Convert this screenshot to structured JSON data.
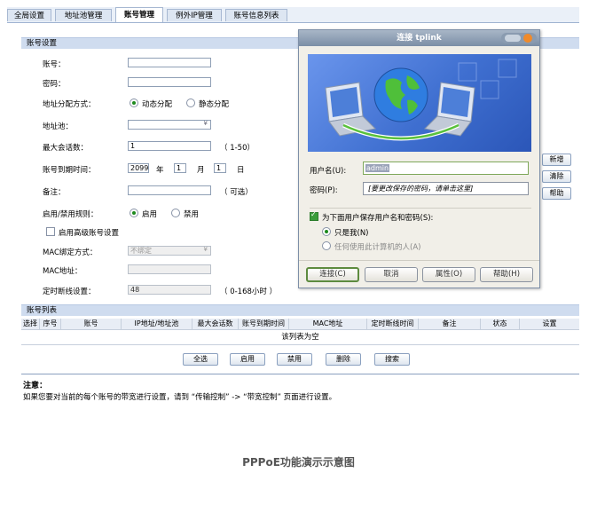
{
  "tabs": [
    "全局设置",
    "地址池管理",
    "账号管理",
    "例外IP管理",
    "账号信息列表"
  ],
  "active_tab": 2,
  "account_settings": {
    "section_title": "账号设置",
    "account_label": "账号：",
    "password_label": "密码：",
    "addr_mode_label": "地址分配方式：",
    "addr_mode_dynamic": "动态分配",
    "addr_mode_static": "静态分配",
    "pool_label": "地址池：",
    "max_session_label": "最大会话数：",
    "max_session_value": "1",
    "max_session_hint": "（ 1-50）",
    "expire_label": "账号到期时间：",
    "expire_year": "2099",
    "year_unit": "年",
    "expire_month": "1",
    "month_unit": "月",
    "expire_day": "1",
    "day_unit": "日",
    "note_label": "备注：",
    "note_hint": "（ 可选）",
    "rule_label": "启用/禁用规则：",
    "rule_enable": "启用",
    "rule_disable": "禁用",
    "advanced_label": "启用高级账号设置",
    "mac_bind_label": "MAC绑定方式：",
    "mac_bind_value": "不绑定",
    "mac_addr_label": "MAC地址：",
    "timeout_label": "定时断线设置：",
    "timeout_value": "48",
    "timeout_hint": "（ 0-168小时 ）"
  },
  "side_buttons": [
    "新增",
    "清除",
    "帮助"
  ],
  "account_list": {
    "section_title": "账号列表",
    "columns": [
      "选择",
      "序号",
      "账号",
      "IP地址/地址池",
      "最大会话数",
      "账号到期时间",
      "MAC地址",
      "定时断线时间",
      "备注",
      "状态",
      "设置"
    ],
    "empty_text": "该列表为空",
    "buttons": [
      "全选",
      "启用",
      "禁用",
      "删除",
      "搜索"
    ]
  },
  "notice": {
    "title": "注意：",
    "text": "如果您要对当前的每个账号的带宽进行设置，请到 “传输控制” -> “带宽控制” 页面进行设置。"
  },
  "dialog": {
    "title": "连接 tplink",
    "username_label": "用户名(U):",
    "username_value": "admin",
    "password_label": "密码(P):",
    "password_value": "[要更改保存的密码，请单击这里]",
    "save_label": "为下面用户保存用户名和密码(S):",
    "only_me": "只是我(N)",
    "anyone": "任何使用此计算机的人(A)",
    "buttons": [
      "连接(C)",
      "取消",
      "属性(O)",
      "帮助(H)"
    ]
  },
  "caption": "PPPoE功能演示示意图",
  "colors": {
    "bar": "#cfdcef",
    "dialog_title": "#7b8ea6",
    "banner": "#3f6fd0",
    "radio_on": "#1d8a1d"
  }
}
